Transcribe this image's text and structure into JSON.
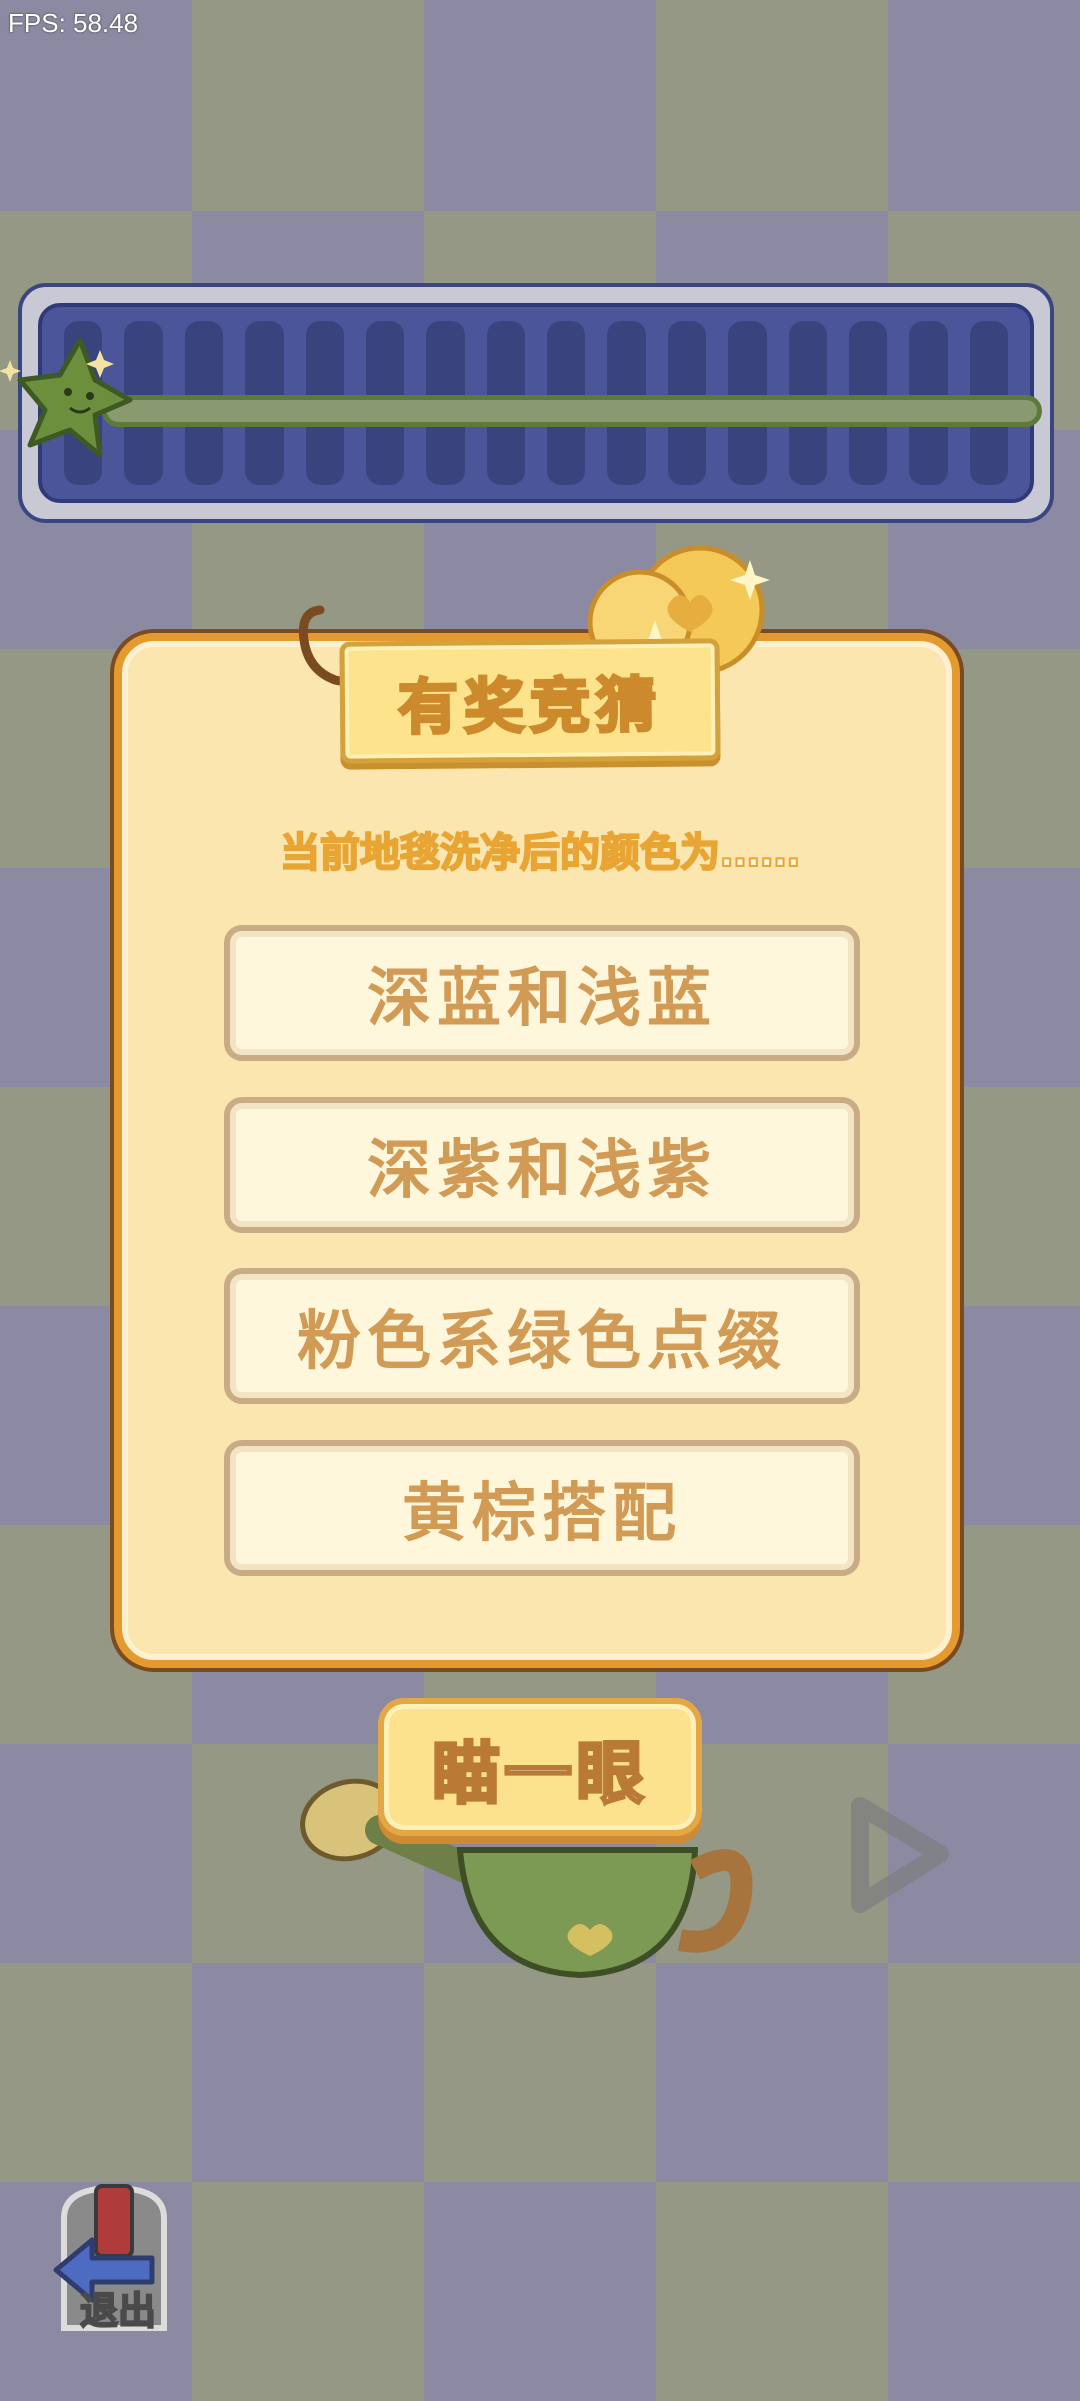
{
  "hud": {
    "fps": "FPS: 58.48"
  },
  "progress": {
    "level": 0.0
  },
  "quiz": {
    "title": "有奖竞猜",
    "question": "当前地毯洗净后的颜色为……",
    "options": [
      {
        "label": "深蓝和浅蓝"
      },
      {
        "label": "深紫和浅紫"
      },
      {
        "label": "粉色系绿色点缀"
      },
      {
        "label": "黄棕搭配"
      }
    ]
  },
  "actions": {
    "peek_label": "瞄一眼",
    "exit_label": "退出"
  },
  "colors": {
    "panel_bg": "#fbe6b0",
    "panel_border": "#e59a2f",
    "option_text": "#d19a55",
    "progress_bg": "#4b5599",
    "checker_green": "#949884",
    "checker_purple": "#8b8aa2"
  },
  "icons": {
    "mascot": "green-star-mascot-icon",
    "coins": "gold-heart-coins-icon",
    "watering_can": "watering-can-icon",
    "next": "play-arrow-icon",
    "exit": "back-arrow-icon"
  }
}
